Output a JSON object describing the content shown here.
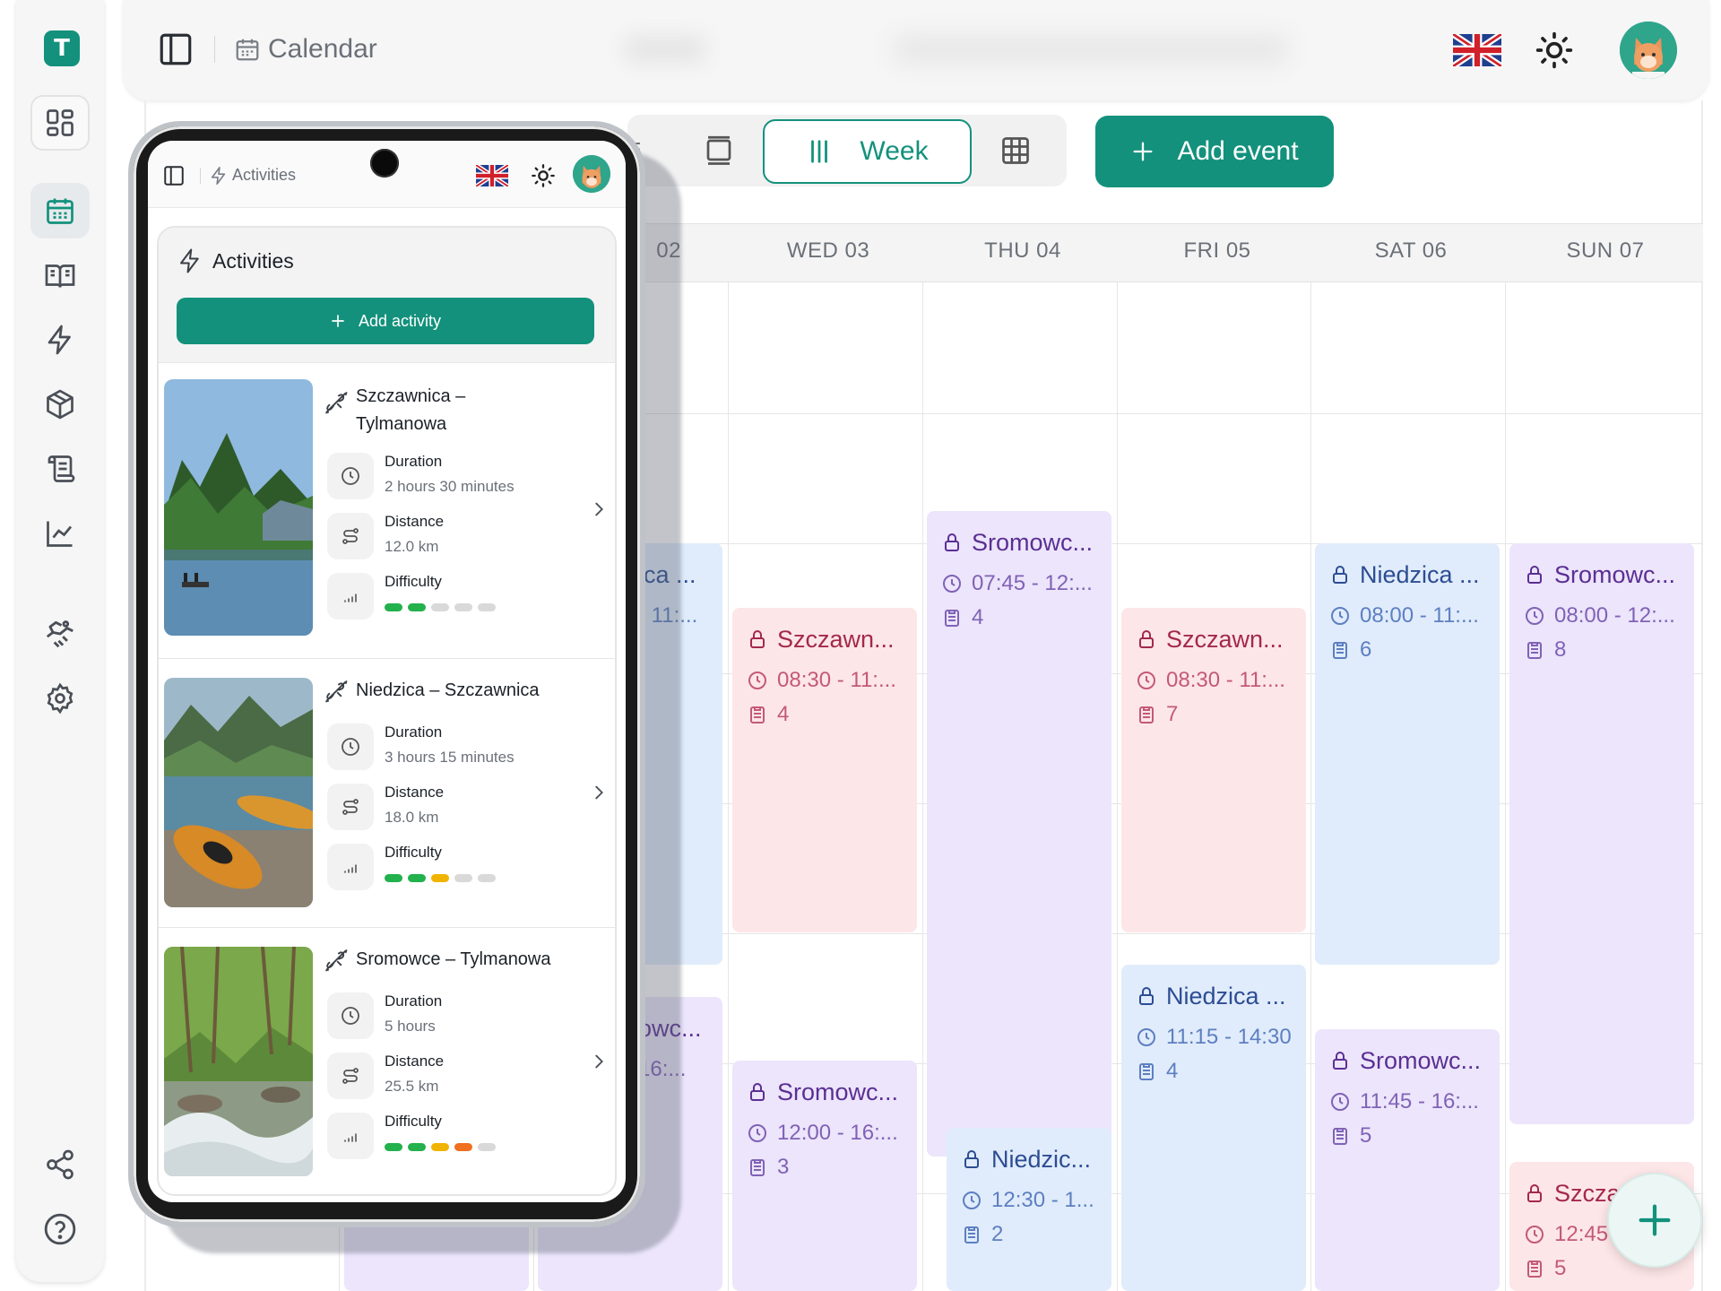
{
  "app": {
    "logo_letter": "T",
    "brand_color": "#13917c"
  },
  "sidebar": {
    "items": [
      {
        "name": "dashboard",
        "icon": "grid-icon"
      },
      {
        "name": "calendar",
        "icon": "calendar-icon",
        "active": true
      },
      {
        "name": "book",
        "icon": "book-open-icon"
      },
      {
        "name": "activities",
        "icon": "bolt-icon"
      },
      {
        "name": "equipment",
        "icon": "box-icon"
      },
      {
        "name": "scroll",
        "icon": "scroll-icon"
      },
      {
        "name": "reports",
        "icon": "chart-line-icon"
      },
      {
        "name": "partners",
        "icon": "handshake-icon"
      },
      {
        "name": "settings",
        "icon": "gear-icon"
      },
      {
        "name": "share",
        "icon": "share-icon"
      },
      {
        "name": "help",
        "icon": "help-icon"
      }
    ]
  },
  "header": {
    "title": "Calendar",
    "language_icon": "uk-flag-icon",
    "theme_icon": "sun-icon"
  },
  "toolbar": {
    "partial_label": "=",
    "week_label": "Week",
    "add_event_label": "Add event"
  },
  "calendar": {
    "days": [
      {
        "label": "02"
      },
      {
        "label": "WED 03"
      },
      {
        "label": "THU 04"
      },
      {
        "label": "FRI 05"
      },
      {
        "label": "SAT 06"
      },
      {
        "label": "SUN 07"
      }
    ],
    "events": [
      {
        "title": "ica ...",
        "time": "- 11:...",
        "color": "blue"
      },
      {
        "title": "owc...",
        "time": "16:...",
        "color": "purple"
      },
      {
        "title": "Szczawn...",
        "time": "08:30 - 11:...",
        "count": "4",
        "color": "pink"
      },
      {
        "title": "Sromowc...",
        "time": "12:00 - 16:...",
        "count": "3",
        "color": "purple"
      },
      {
        "title": "Sromowc...",
        "time": "07:45 - 12:...",
        "count": "4",
        "color": "purple"
      },
      {
        "title": "Niedzic...",
        "time": "12:30 - 1...",
        "count": "2",
        "color": "blue"
      },
      {
        "title": "Szczawn...",
        "time": "08:30 - 11:...",
        "count": "7",
        "color": "pink"
      },
      {
        "title": "Niedzica ...",
        "time": "11:15 - 14:30",
        "count": "4",
        "color": "blue"
      },
      {
        "title": "Niedzica ...",
        "time": "08:00 - 11:...",
        "count": "6",
        "color": "blue"
      },
      {
        "title": "Sromowc...",
        "time": "11:45 - 16:...",
        "count": "5",
        "color": "purple"
      },
      {
        "title": "Sromowc...",
        "time": "08:00 - 12:...",
        "count": "8",
        "color": "purple"
      },
      {
        "title": "Szcza",
        "time": "12:45",
        "count": "5",
        "color": "pink"
      }
    ]
  },
  "phone": {
    "header_title": "Activities",
    "card_title": "Activities",
    "add_activity_label": "Add activity",
    "activities": [
      {
        "name": "Szczawnica – Tylmanowa",
        "duration_label": "Duration",
        "duration": "2 hours 30 minutes",
        "distance_label": "Distance",
        "distance": "12.0 km",
        "difficulty_label": "Difficulty",
        "difficulty_level": 2
      },
      {
        "name": "Niedzica – Szczawnica",
        "duration_label": "Duration",
        "duration": "3 hours 15 minutes",
        "distance_label": "Distance",
        "distance": "18.0 km",
        "difficulty_label": "Difficulty",
        "difficulty_level": 3
      },
      {
        "name": "Sromowce – Tylmanowa",
        "duration_label": "Duration",
        "duration": "5 hours",
        "distance_label": "Distance",
        "distance": "25.5 km",
        "difficulty_label": "Difficulty",
        "difficulty_level": 4
      }
    ],
    "difficulty_colors": [
      "#22b14c",
      "#22b14c",
      "#f0b400",
      "#f07020",
      "#d9d9d9"
    ]
  }
}
